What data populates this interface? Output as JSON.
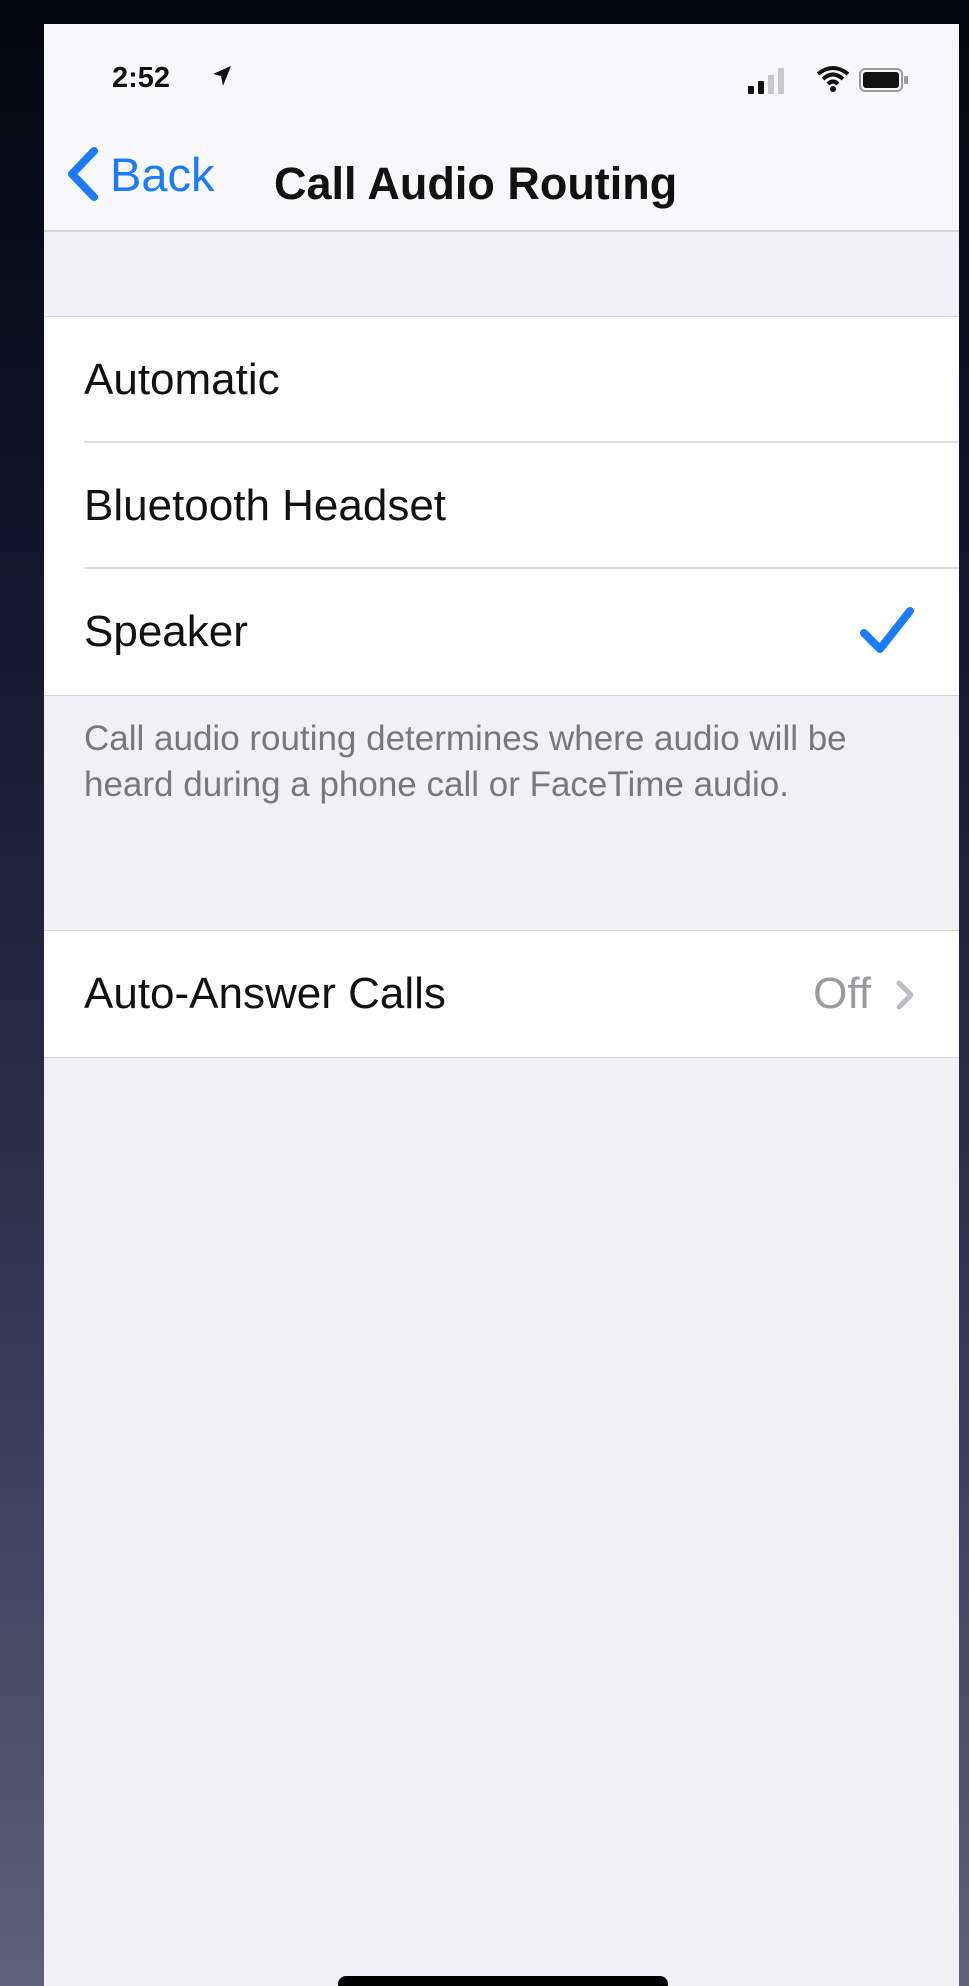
{
  "status": {
    "time": "2:52",
    "location_icon": "location-arrow-icon",
    "signal_icon": "signal-icon",
    "wifi_icon": "wifi-icon",
    "battery_icon": "battery-icon"
  },
  "nav": {
    "back_label": "Back",
    "back_icon": "chevron-left-icon",
    "title": "Call Audio Routing"
  },
  "routing": {
    "options": [
      {
        "label": "Automatic",
        "selected": false
      },
      {
        "label": "Bluetooth Headset",
        "selected": false
      },
      {
        "label": "Speaker",
        "selected": true
      }
    ],
    "footer": "Call audio routing determines where audio will be heard during a phone call or FaceTime audio."
  },
  "auto_answer": {
    "label": "Auto-Answer Calls",
    "value": "Off",
    "icon": "chevron-right-icon"
  },
  "colors": {
    "accent": "#1a7cf6",
    "background": "#f0f0f5",
    "secondary_text": "#77777c"
  }
}
